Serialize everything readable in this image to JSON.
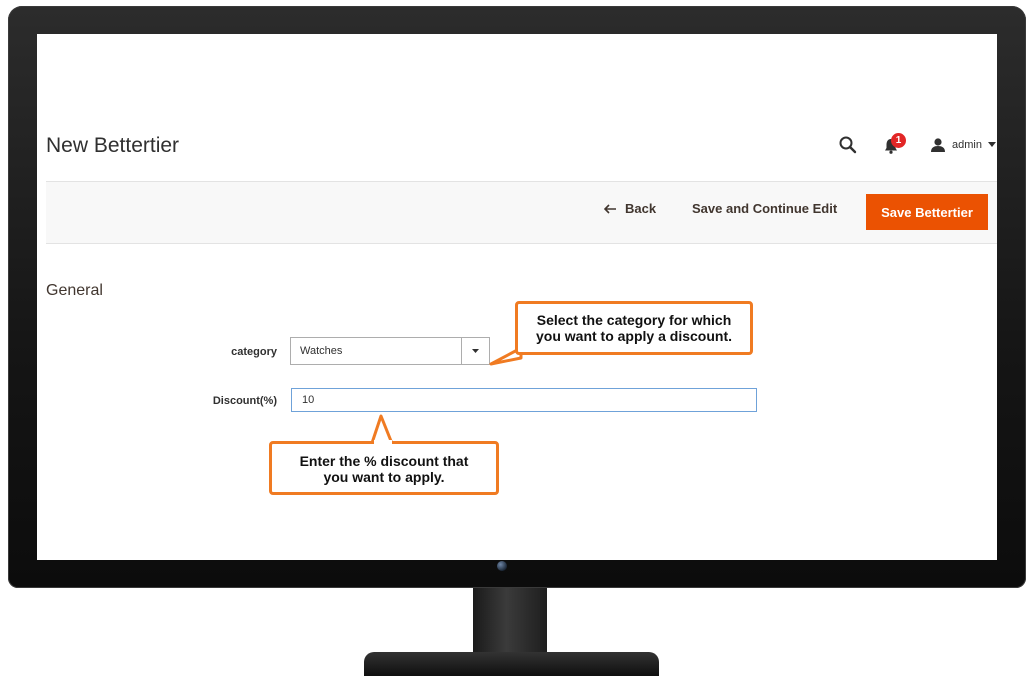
{
  "page": {
    "title": "New Bettertier"
  },
  "header": {
    "notifications_count": "1",
    "user_name": "admin"
  },
  "actions": {
    "back_label": "Back",
    "save_continue_label": "Save and Continue Edit",
    "save_label": "Save Bettertier"
  },
  "form": {
    "section_title": "General",
    "category_label": "category",
    "category_value": "Watches",
    "discount_label": "Discount(%)",
    "discount_value": "10"
  },
  "callouts": {
    "category_line1": "Select the category for which",
    "category_line2": "you want to apply a discount.",
    "discount_line1": "Enter the % discount that",
    "discount_line2": "you want to apply."
  },
  "colors": {
    "primary_button": "#eb5202",
    "callout_border": "#f07b22",
    "badge": "#e22626",
    "input_focus": "#6fa2d9"
  },
  "icons": [
    "search-icon",
    "bell-icon",
    "user-icon",
    "chevron-down-icon",
    "arrow-left-icon",
    "dropdown-arrow-icon"
  ]
}
